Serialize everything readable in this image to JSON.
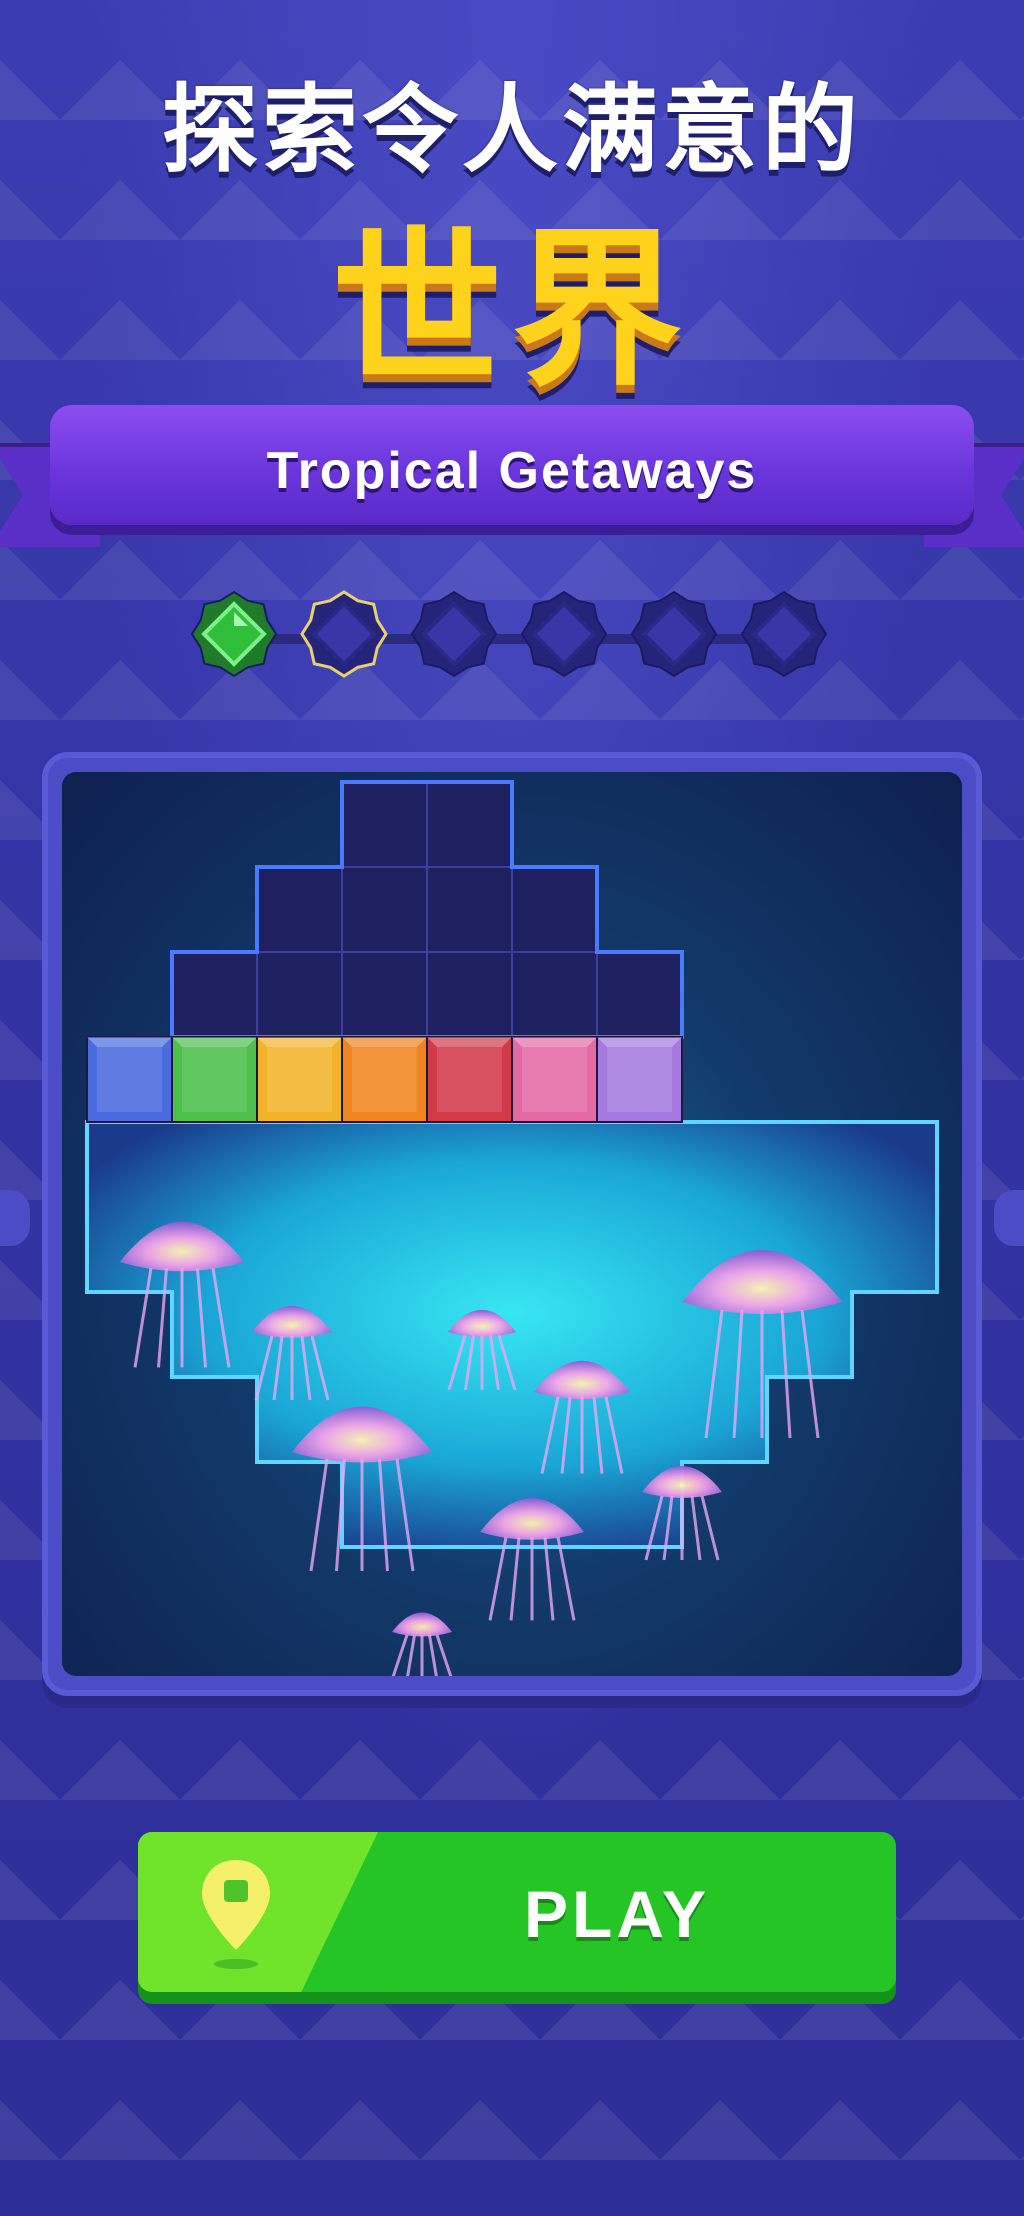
{
  "headline": {
    "line1": "探索令人满意的",
    "line2": "世界"
  },
  "ribbon": {
    "title": "Tropical Getaways"
  },
  "progress": {
    "total_levels": 6,
    "completed_levels": 1,
    "gems": [
      {
        "state": "completed",
        "color": "#2fbf3a",
        "icon": "green-gem-icon"
      },
      {
        "state": "current",
        "color": "#3a36a8",
        "icon": "gem-slot-icon"
      },
      {
        "state": "locked",
        "color": "#3a36a8",
        "icon": "gem-slot-icon"
      },
      {
        "state": "locked",
        "color": "#3a36a8",
        "icon": "gem-slot-icon"
      },
      {
        "state": "locked",
        "color": "#3a36a8",
        "icon": "gem-slot-icon"
      },
      {
        "state": "locked",
        "color": "#3a36a8",
        "icon": "gem-slot-icon"
      }
    ]
  },
  "board": {
    "scene": "glowing jellyfish underwater illustration",
    "block_row_colors": [
      "#4a6ae0",
      "#4cc04a",
      "#f2b32a",
      "#f0841e",
      "#d23a4a",
      "#e46aa6",
      "#a47ae0"
    ]
  },
  "play_button": {
    "label": "PLAY",
    "icon": "map-pin-icon"
  },
  "colors": {
    "background": "#3434a6",
    "accent_yellow": "#ffd21c",
    "ribbon": "#6a36dc",
    "play_green": "#25c525"
  }
}
